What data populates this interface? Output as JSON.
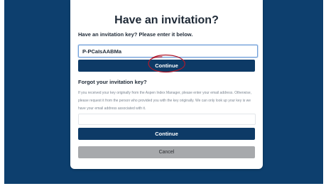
{
  "dialog": {
    "title": "Have an invitation?",
    "key_prompt": "Have an invitation key? Please enter it below.",
    "key_value": "P-PCaIsAABMa",
    "continue_label": "Continue"
  },
  "forgot": {
    "heading": "Forgot your invitation key?",
    "help_text": "If you received your key originally from the Aspen Index Manager, please enter your email address. Otherwise, please request it from the person who provided you with the key originally. We can only look up your key is we have your email address associated with it.",
    "email_value": "",
    "continue_label": "Continue",
    "cancel_label": "Cancel"
  },
  "colors": {
    "backdrop": "#0d3f6e",
    "primary_button": "#0d3a66",
    "cancel_button": "#a7a9ac",
    "annotation": "#b0182a"
  }
}
